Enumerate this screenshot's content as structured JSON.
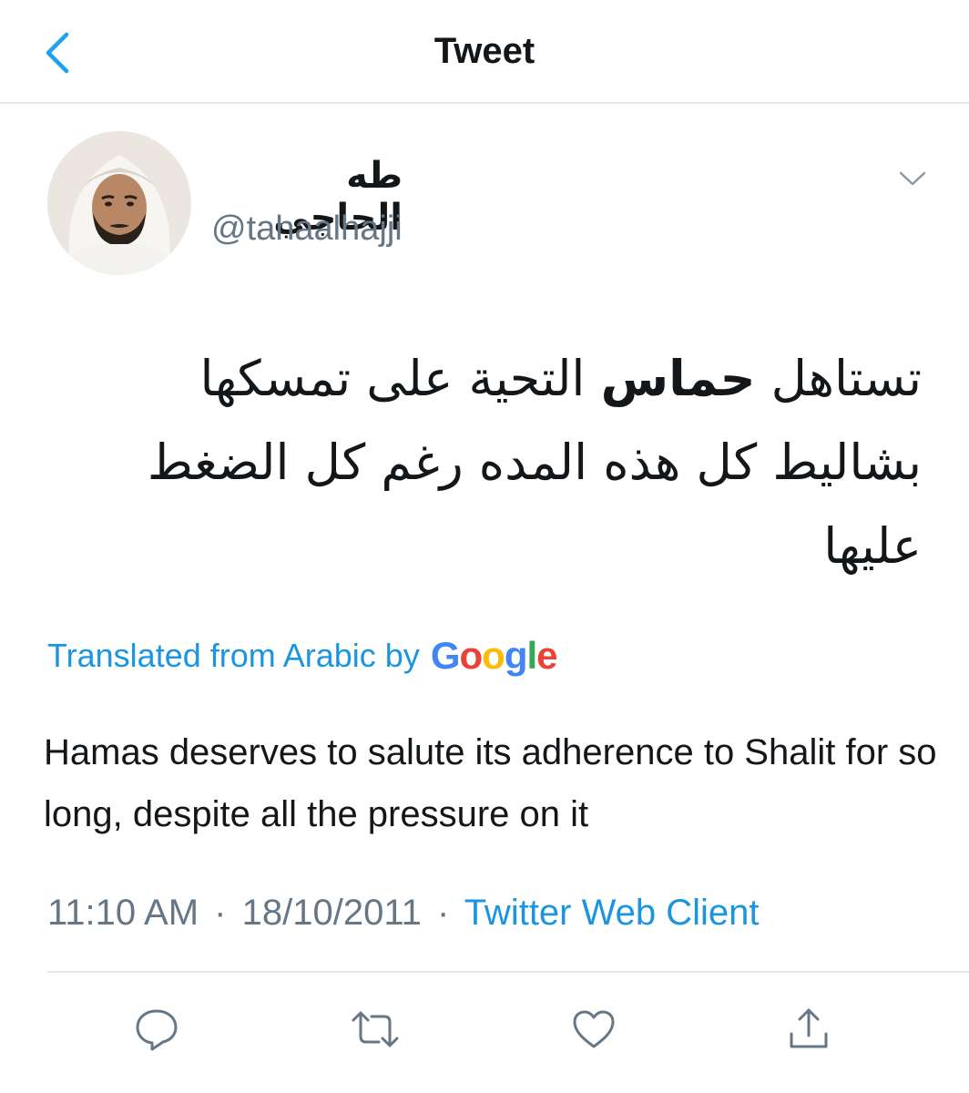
{
  "header": {
    "title": "Tweet"
  },
  "tweet": {
    "author": {
      "display_name": "طه الحاجي",
      "handle": "@tahaalhajji"
    },
    "text_parts": {
      "before_bold": "تستاهل ",
      "bold": "حماس",
      "after_bold": " التحية على تمسكها بشاليط كل هذه المده رغم كل الضغط عليها"
    },
    "translation": {
      "label": "Translated from Arabic by",
      "provider": "Google",
      "text": "Hamas deserves to salute its adherence to Shalit for so long, despite all the pressure on it"
    },
    "meta": {
      "time": "11:10 AM",
      "separator": "·",
      "date": "18/10/2011",
      "source": "Twitter Web Client"
    }
  },
  "icons": {
    "back": "chevron-left-icon",
    "caret": "chevron-down-icon",
    "reply": "reply-icon",
    "retweet": "retweet-icon",
    "like": "heart-icon",
    "share": "share-icon"
  },
  "colors": {
    "accent": "#1b95e0",
    "secondary_text": "#657786",
    "primary_text": "#14171a",
    "divider": "#e1e8ed"
  }
}
